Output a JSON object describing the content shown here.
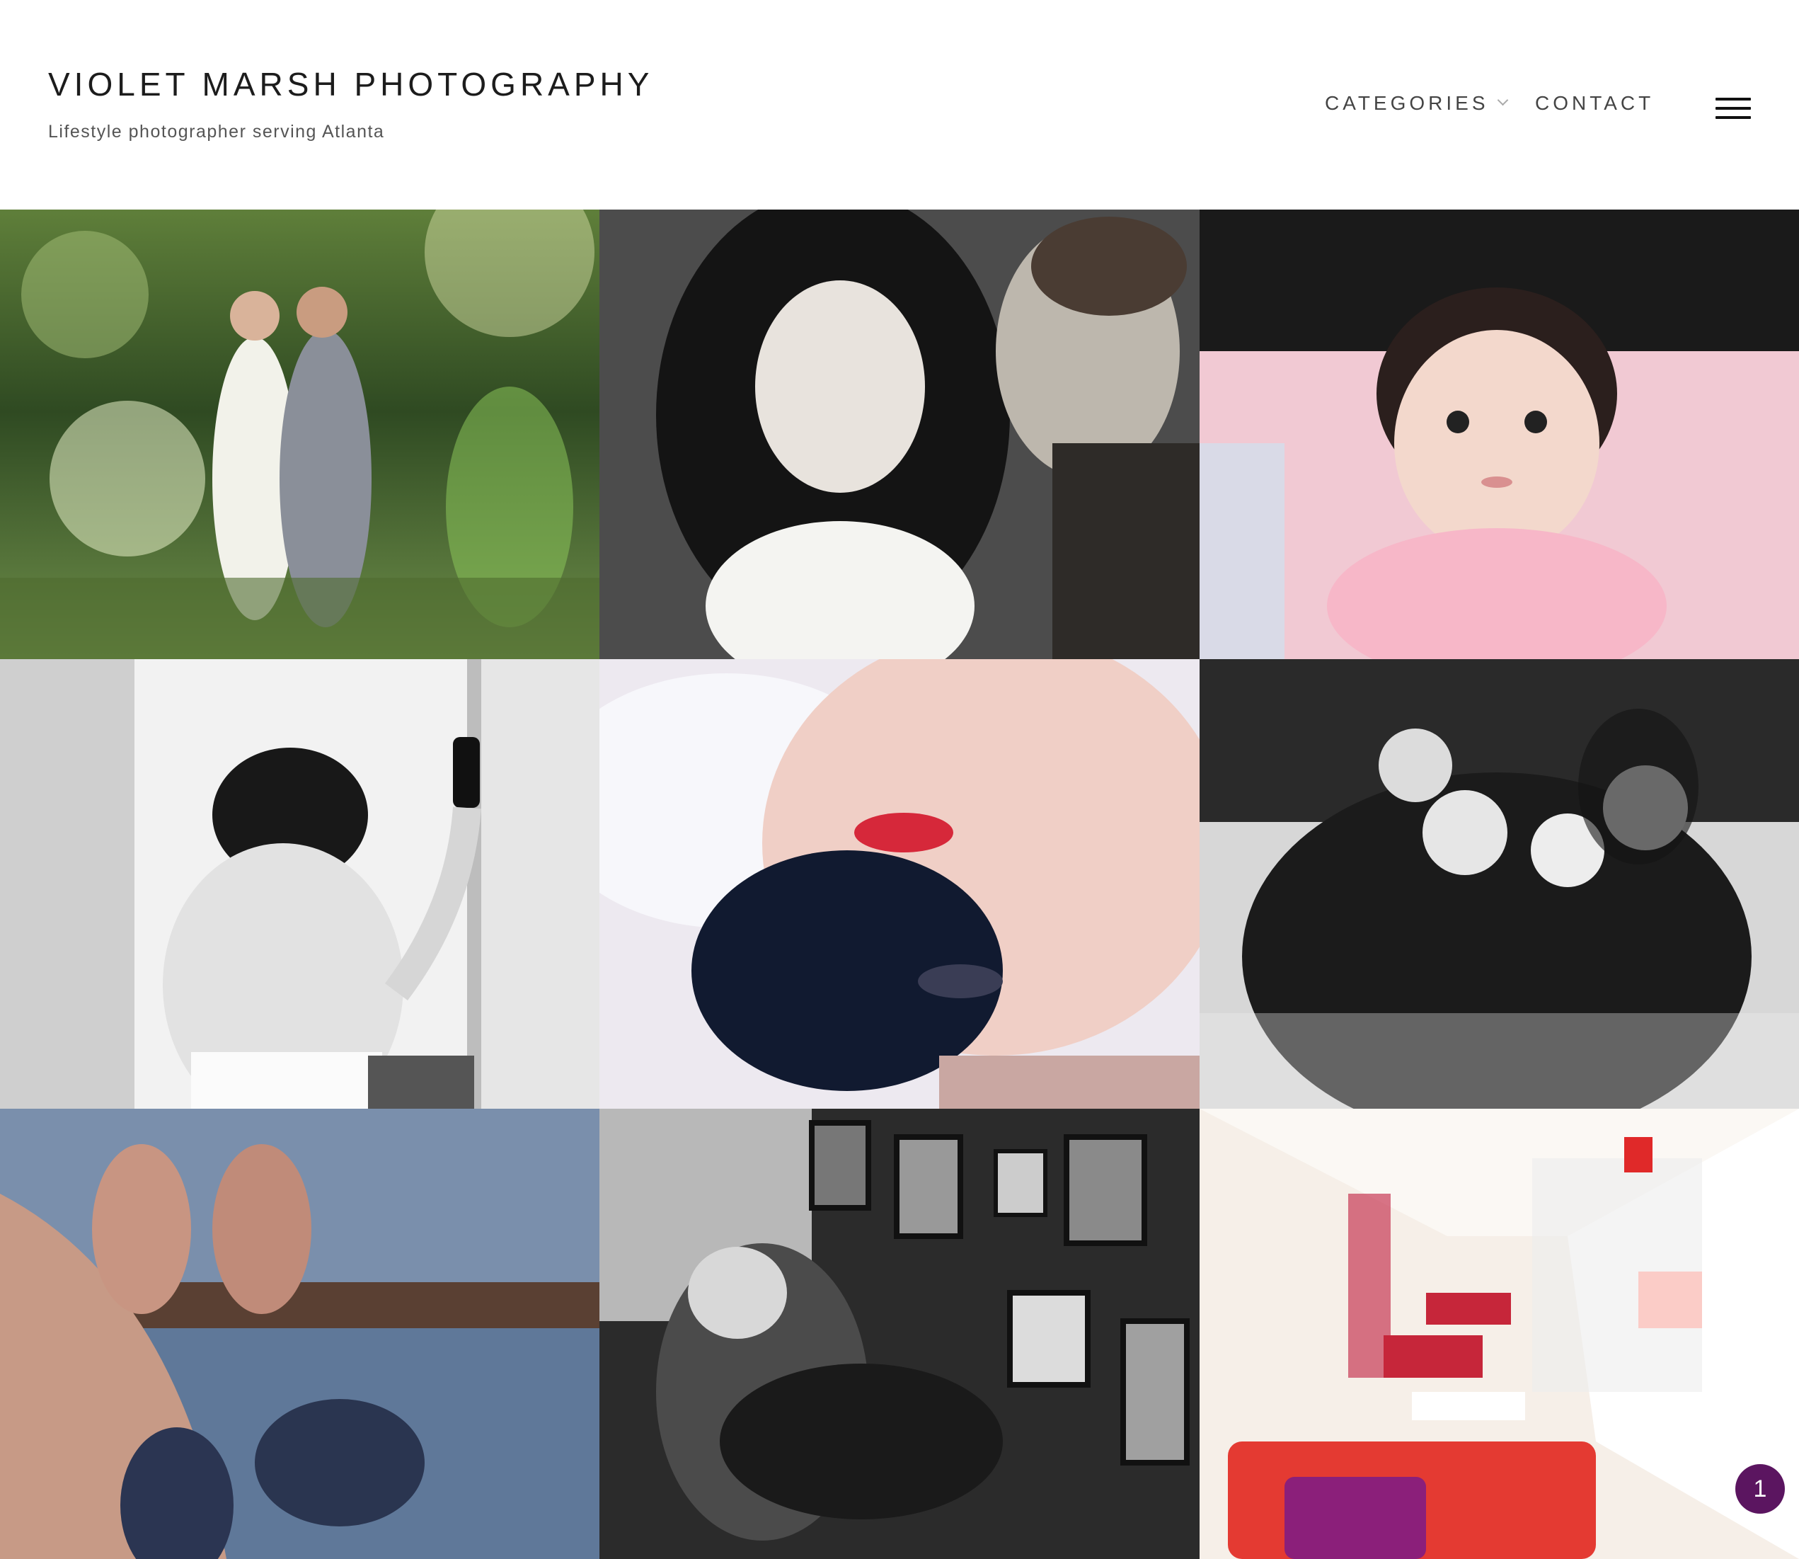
{
  "site": {
    "title": "VIOLET MARSH PHOTOGRAPHY",
    "tagline": "Lifestyle photographer serving Atlanta"
  },
  "nav": {
    "categories_label": "CATEGORIES",
    "contact_label": "CONTACT",
    "menu_icon": "hamburger-menu-icon"
  },
  "gallery": {
    "photos": [
      {
        "subject": "wedding couple in meadow"
      },
      {
        "subject": "couple lying in grass, black and white"
      },
      {
        "subject": "baby portrait"
      },
      {
        "subject": "bride spraying hairspray, black and white"
      },
      {
        "subject": "woman upside down with red lips"
      },
      {
        "subject": "family hug, black and white"
      },
      {
        "subject": "feet and flip flops on sand"
      },
      {
        "subject": "man smoking in frame-filled room, black and white"
      },
      {
        "subject": "red lounge interior"
      }
    ]
  },
  "notification_badge": {
    "count": "1",
    "color": "#5b1560"
  }
}
